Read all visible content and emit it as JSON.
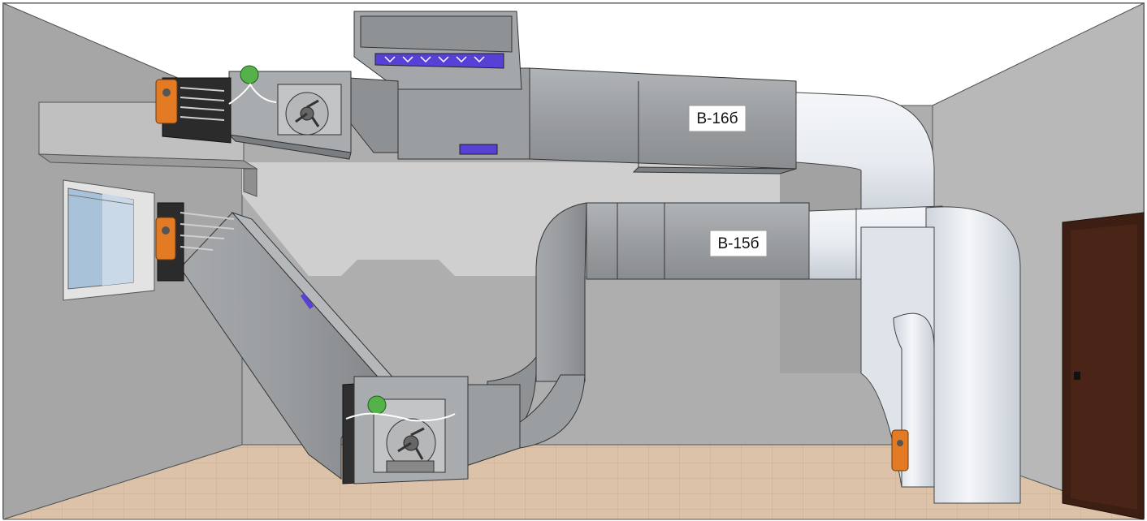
{
  "labels": {
    "duct_upper": "В-16б",
    "duct_lower": "В-15б"
  },
  "colors": {
    "wall": "#a9a9a9",
    "side_wall": "#b9b9b9",
    "ceiling": "#ffffff",
    "floor_tile": "#dcc2a8",
    "duct_metal": "#9ea1a4",
    "insulation": "#e9ecf0",
    "actuator": "#e37b25",
    "sensor_green": "#55b24a",
    "grille_blue": "#5640d6",
    "door": "#3d1e12"
  },
  "equipment": {
    "fans": 2,
    "damper_actuators": 3,
    "flow_sensors": 2
  }
}
